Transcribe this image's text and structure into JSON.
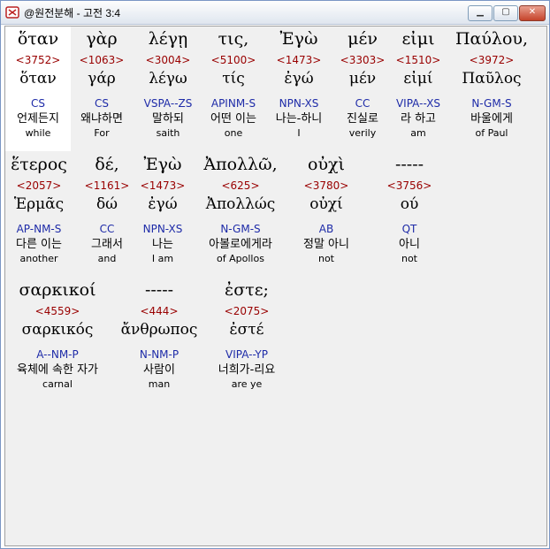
{
  "window": {
    "title": "@원전분해 - 고전 3:4",
    "minimize_label": "▁",
    "maximize_label": "▢",
    "close_label": "✕"
  },
  "rows": [
    {
      "words": [
        {
          "surface": "ὅταν",
          "strong": "<3752>",
          "lemma": "ὅταν",
          "parse": "CS",
          "korean": "언제든지",
          "english": "while"
        },
        {
          "surface": "γὰρ",
          "strong": "<1063>",
          "lemma": "γάρ",
          "parse": "CS",
          "korean": "왜냐하면",
          "english": "For"
        },
        {
          "surface": "λέγῃ",
          "strong": "<3004>",
          "lemma": "λέγω",
          "parse": "VSPA--ZS",
          "korean": "말하되",
          "english": "saith"
        },
        {
          "surface": "τις,",
          "strong": "<5100>",
          "lemma": "τίς",
          "parse": "APINM-S",
          "korean": "어떤 이는",
          "english": "one"
        },
        {
          "surface": "Ἐγὼ",
          "strong": "<1473>",
          "lemma": "ἐγώ",
          "parse": "NPN-XS",
          "korean": "나는-하니",
          "english": "I"
        },
        {
          "surface": "μέν",
          "strong": "<3303>",
          "lemma": "μέν",
          "parse": "CC",
          "korean": "진실로",
          "english": "verily"
        },
        {
          "surface": "εἰμι",
          "strong": "<1510>",
          "lemma": "εἰμί",
          "parse": "VIPA--XS",
          "korean": "라 하고",
          "english": "am"
        },
        {
          "surface": "Παύλου,",
          "strong": "<3972>",
          "lemma": "Παῦλος",
          "parse": "N-GM-S",
          "korean": "바울에게",
          "english": "of Paul"
        }
      ]
    },
    {
      "words": [
        {
          "surface": "ἕτερος",
          "strong": "<2057>",
          "lemma": "Ἑρμᾶς",
          "parse": "AP-NM-S",
          "korean": "다른 이는",
          "english": "another"
        },
        {
          "surface": "δέ,",
          "strong": "<1161>",
          "lemma": "δώ",
          "parse": "CC",
          "korean": "그래서",
          "english": "and"
        },
        {
          "surface": "Ἐγὼ",
          "strong": "<1473>",
          "lemma": "ἐγώ",
          "parse": "NPN-XS",
          "korean": "나는",
          "english": "I am"
        },
        {
          "surface": "Ἀπολλῶ,",
          "strong": "<625>",
          "lemma": "Ἀπολλώς",
          "parse": "N-GM-S",
          "korean": "아볼로에게라",
          "english": "of Apollos"
        },
        {
          "surface": "οὐχὶ",
          "strong": "<3780>",
          "lemma": "οὐχί",
          "parse": "AB",
          "korean": "정말 아니",
          "english": "not"
        },
        {
          "surface": "-----",
          "strong": "<3756>",
          "lemma": "ού",
          "parse": "QT",
          "korean": "아니",
          "english": "not"
        }
      ]
    },
    {
      "words": [
        {
          "surface": "σαρκικοί",
          "strong": "<4559>",
          "lemma": "σαρκικός",
          "parse": "A--NM-P",
          "korean": "육체에 속한 자가",
          "english": "carnal"
        },
        {
          "surface": "-----",
          "strong": "<444>",
          "lemma": "ἄνθρωπος",
          "parse": "N-NM-P",
          "korean": "사람이",
          "english": "man"
        },
        {
          "surface": "ἐστε;",
          "strong": "<2075>",
          "lemma": "ἐστέ",
          "parse": "VIPA--YP",
          "korean": "너희가-리요",
          "english": "are ye"
        }
      ]
    }
  ]
}
